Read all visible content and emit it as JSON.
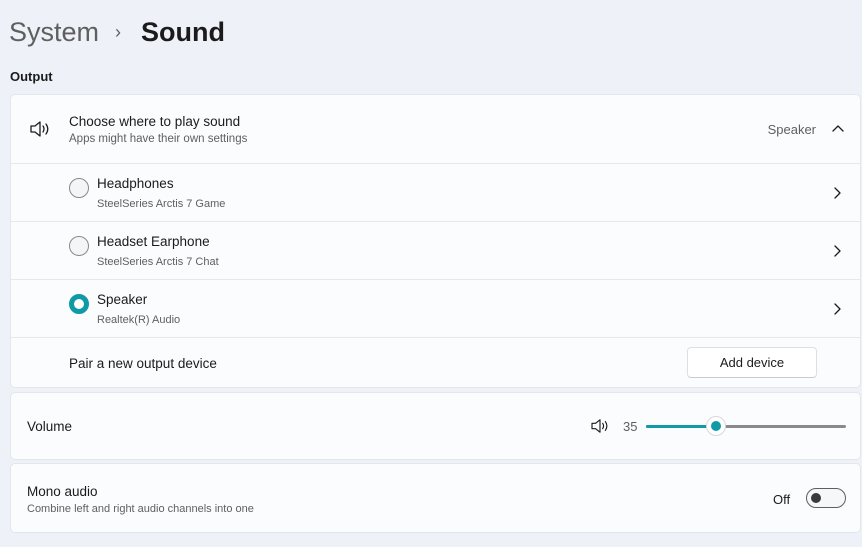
{
  "breadcrumb": {
    "parent": "System",
    "separator": "›",
    "current": "Sound"
  },
  "output_section": {
    "label": "Output",
    "chooser": {
      "title": "Choose where to play sound",
      "subtitle": "Apps might have their own settings",
      "selected_value": "Speaker",
      "expanded": true
    },
    "devices": [
      {
        "name": "Headphones",
        "detail": "SteelSeries Arctis 7 Game",
        "selected": false
      },
      {
        "name": "Headset Earphone",
        "detail": "SteelSeries Arctis 7 Chat",
        "selected": false
      },
      {
        "name": "Speaker",
        "detail": "Realtek(R) Audio",
        "selected": true
      }
    ],
    "pair": {
      "label": "Pair a new output device",
      "button": "Add device"
    }
  },
  "volume": {
    "label": "Volume",
    "value": "35",
    "level_percent": 35
  },
  "mono_audio": {
    "title": "Mono audio",
    "subtitle": "Combine left and right audio channels into one",
    "state_label": "Off",
    "enabled": false
  },
  "colors": {
    "accent": "#0f9aa8",
    "background": "#eef2f8",
    "card": "#fbfcfe"
  },
  "icons": {
    "speaker": "speaker-volume-icon",
    "chevron_right": "chevron-right-icon",
    "chevron_up": "chevron-up-icon"
  }
}
